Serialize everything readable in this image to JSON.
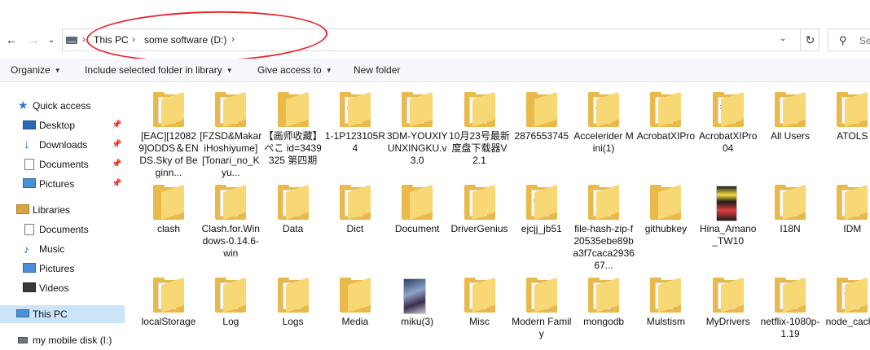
{
  "address": {
    "crumbs": [
      "This PC",
      "some software (D:)"
    ],
    "separator": "›",
    "search_placeholder": "Se"
  },
  "nav_buttons": {
    "back": "←",
    "forward": "→",
    "recent": "⌄",
    "up": "↑"
  },
  "toolbar": {
    "organize": "Organize",
    "include": "Include selected folder in library",
    "share": "Give access to",
    "new_folder": "New folder"
  },
  "sidebar": {
    "quick_access": "Quick access",
    "quick_items": [
      "Desktop",
      "Downloads",
      "Documents",
      "Pictures"
    ],
    "libraries": "Libraries",
    "library_items": [
      "Documents",
      "Music",
      "Pictures",
      "Videos"
    ],
    "this_pc": "This PC",
    "mobile_disk": "my mobile disk (I:)"
  },
  "files": [
    {
      "name": "[EAC][120829]ODDS＆ENDS.Sky of Beginn...",
      "type": "vlc"
    },
    {
      "name": "[FZSD&MakariHoshiyume][Tonari_no_Kyu...",
      "type": "doc"
    },
    {
      "name": "【画师收藏】ぺこ id=3439325 第四期",
      "type": "empty"
    },
    {
      "name": "1-1P123105R4",
      "type": "app"
    },
    {
      "name": "3DM-YOUXIYUNXINGKU.v3.0",
      "type": "doc"
    },
    {
      "name": "10月23号最新度盘下载器V2.1",
      "type": "doc"
    },
    {
      "name": "2876553745",
      "type": "empty"
    },
    {
      "name": "Accelerider Mini(1)",
      "type": "code"
    },
    {
      "name": "AcrobatXIPro",
      "type": "doc"
    },
    {
      "name": "AcrobatXIPro04",
      "type": "gear"
    },
    {
      "name": "All Users",
      "type": "doc"
    },
    {
      "name": "ATOLS",
      "type": "doc"
    },
    {
      "name": "clash",
      "type": "empty"
    },
    {
      "name": "Clash.for.Windows-0.14.6-win",
      "type": "doc"
    },
    {
      "name": "Data",
      "type": "doc"
    },
    {
      "name": "Dict",
      "type": "doc"
    },
    {
      "name": "Document",
      "type": "empty"
    },
    {
      "name": "DriverGenius",
      "type": "doc"
    },
    {
      "name": "ejcjj_jb51",
      "type": "app"
    },
    {
      "name": "file-hash-zip-f20535ebe89ba3f7caca293667...",
      "type": "doc"
    },
    {
      "name": "githubkey",
      "type": "empty"
    },
    {
      "name": "Hina_Amano_TW10",
      "type": "image2"
    },
    {
      "name": "I18N",
      "type": "doc"
    },
    {
      "name": "IDM",
      "type": "doc"
    },
    {
      "name": "localStorage",
      "type": "doc"
    },
    {
      "name": "Log",
      "type": "doc"
    },
    {
      "name": "Logs",
      "type": "doc"
    },
    {
      "name": "Media",
      "type": "empty"
    },
    {
      "name": "miku(3)",
      "type": "image"
    },
    {
      "name": "Misc",
      "type": "doc"
    },
    {
      "name": "Modern Family",
      "type": "doc"
    },
    {
      "name": "mongodb",
      "type": "doc"
    },
    {
      "name": "Mulstism",
      "type": "doc"
    },
    {
      "name": "MyDrivers",
      "type": "doc"
    },
    {
      "name": "netflix-1080p-1.19",
      "type": "doc"
    },
    {
      "name": "node_cache",
      "type": "code"
    }
  ],
  "colors": {
    "accent": "#0078d7",
    "selected": "#cce4f7",
    "folder": "#f8d775",
    "annotation": "#e8242b"
  }
}
